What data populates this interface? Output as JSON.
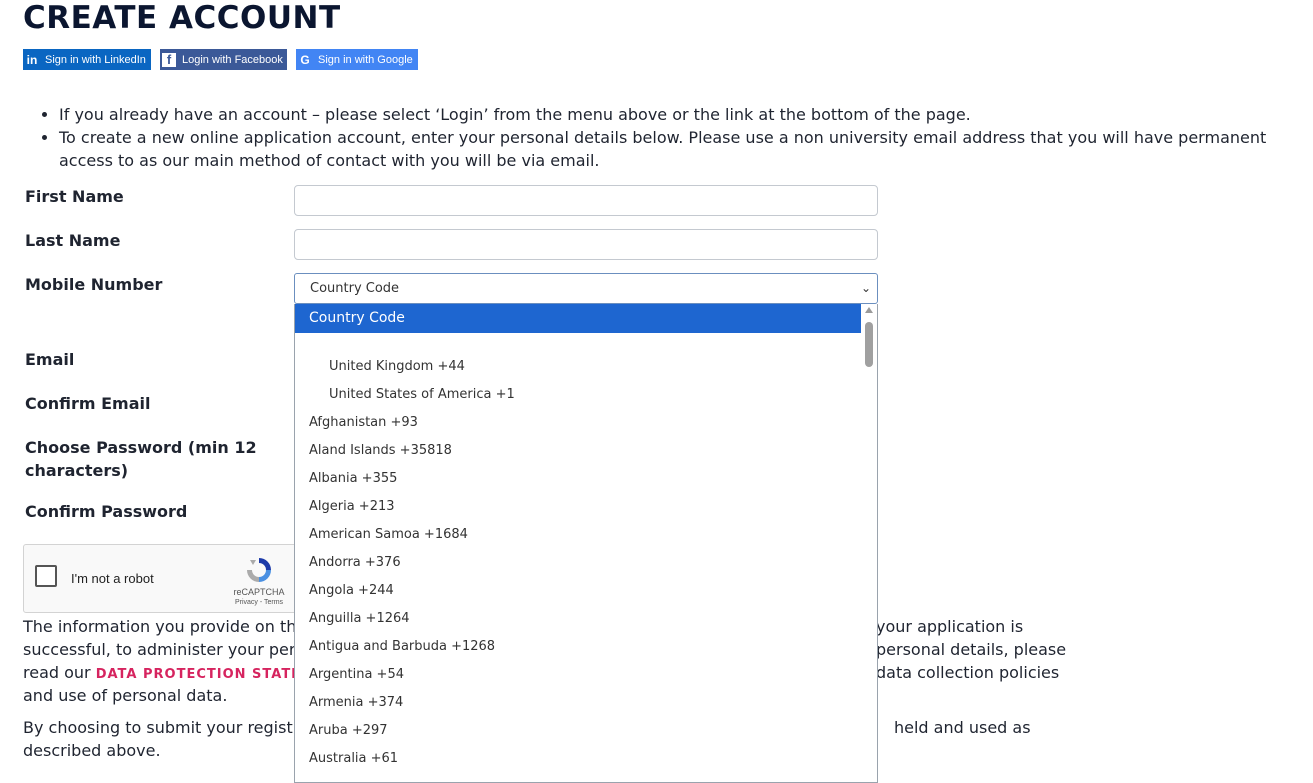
{
  "page": {
    "title": "CREATE ACCOUNT"
  },
  "social": {
    "linkedin": "Sign in with LinkedIn",
    "facebook": "Login with Facebook",
    "google": "Sign in with Google"
  },
  "info": [
    "If you already have an account – please select ‘Login’ from the menu above or the link at the bottom of the page.",
    "To create a new online application account, enter your personal details below. Please use a non university email address that you will have permanent access to as our main method of contact with you will be via email."
  ],
  "form": {
    "first_name": "First Name",
    "last_name": "Last Name",
    "mobile": "Mobile Number",
    "email": "Email",
    "confirm_email": "Confirm Email",
    "password_line1": "Choose Password (min 12",
    "password_line2": "characters)",
    "confirm_password": "Confirm Password",
    "country_select": "Country Code"
  },
  "dropdown": {
    "selected": "Country Code",
    "options": [
      "United Kingdom +44",
      "United States of America +1",
      "Afghanistan +93",
      "Aland Islands +35818",
      "Albania +355",
      "Algeria +213",
      "American Samoa +1684",
      "Andorra +376",
      "Angola +244",
      "Anguilla +1264",
      "Antigua and Barbuda +1268",
      "Argentina +54",
      "Armenia +374",
      "Aruba +297",
      "Australia +61"
    ]
  },
  "captcha": {
    "label": "I'm not a robot",
    "brand": "reCAPTCHA",
    "terms": "Privacy - Terms"
  },
  "footer": {
    "p1_l1a": "The information you provide on th",
    "p1_l1b": "your application is",
    "p1_l2a": "successful, to administer your per",
    "p1_l2b": "personal details, please",
    "p1_l3a": "read our",
    "p1_link": "DATA PROTECTION STATEM",
    "p1_l3b": "data collection policies",
    "p1_l4": "and use of personal data.",
    "p2_l1a": "By choosing to submit your registr",
    "p2_l1b": "held and used as",
    "p2_l2": "described above."
  }
}
